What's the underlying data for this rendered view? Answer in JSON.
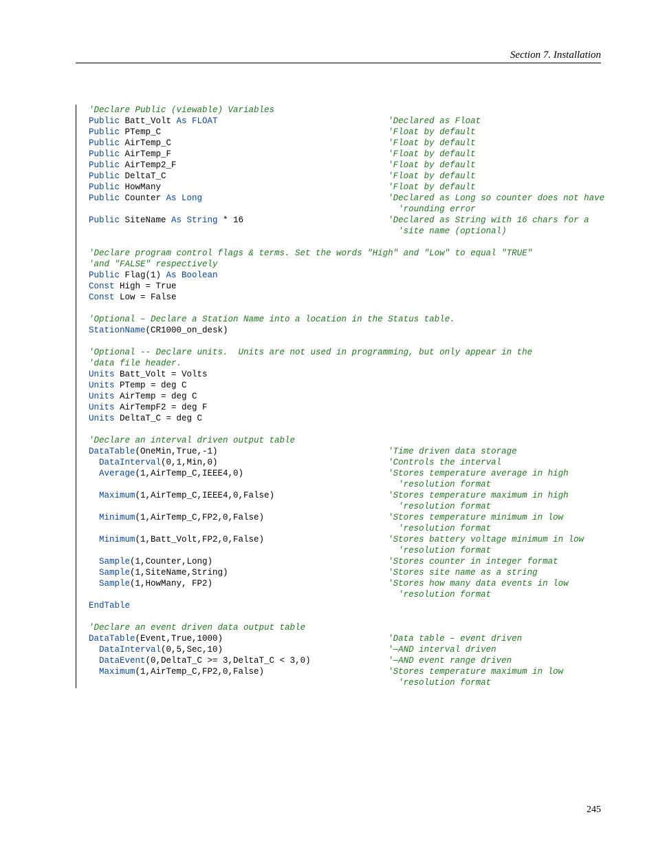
{
  "header": "Section 7.  Installation",
  "page_number": "245",
  "code_lines": [
    [
      [
        "c",
        "'Declare Public (viewable) Variables"
      ]
    ],
    [
      [
        "kw",
        "Public"
      ],
      [
        "t",
        " Batt_Volt "
      ],
      [
        "kw",
        "As FLOAT"
      ],
      [
        "pad",
        456
      ],
      [
        "c",
        "'Declared as Float"
      ]
    ],
    [
      [
        "kw",
        "Public"
      ],
      [
        "t",
        " PTemp_C"
      ],
      [
        "pad",
        456
      ],
      [
        "c",
        "'Float by default"
      ]
    ],
    [
      [
        "kw",
        "Public"
      ],
      [
        "t",
        " AirTemp_C"
      ],
      [
        "pad",
        456
      ],
      [
        "c",
        "'Float by default"
      ]
    ],
    [
      [
        "kw",
        "Public"
      ],
      [
        "t",
        " AirTemp_F"
      ],
      [
        "pad",
        456
      ],
      [
        "c",
        "'Float by default"
      ]
    ],
    [
      [
        "kw",
        "Public"
      ],
      [
        "t",
        " AirTemp2_F"
      ],
      [
        "pad",
        456
      ],
      [
        "c",
        "'Float by default"
      ]
    ],
    [
      [
        "kw",
        "Public"
      ],
      [
        "t",
        " DeltaT_C"
      ],
      [
        "pad",
        456
      ],
      [
        "c",
        "'Float by default"
      ]
    ],
    [
      [
        "kw",
        "Public"
      ],
      [
        "t",
        " HowMany"
      ],
      [
        "pad",
        456
      ],
      [
        "c",
        "'Float by default"
      ]
    ],
    [
      [
        "kw",
        "Public"
      ],
      [
        "t",
        " Counter "
      ],
      [
        "kw",
        "As Long"
      ],
      [
        "pad",
        456
      ],
      [
        "c",
        "'Declared as Long so counter does not have"
      ]
    ],
    [
      [
        "pad",
        471
      ],
      [
        "c",
        "'rounding error"
      ]
    ],
    [
      [
        "kw",
        "Public"
      ],
      [
        "t",
        " SiteName "
      ],
      [
        "kw",
        "As String"
      ],
      [
        "t",
        " * 16"
      ],
      [
        "pad",
        456
      ],
      [
        "c",
        "'Declared as String with 16 chars for a"
      ]
    ],
    [
      [
        "pad",
        471
      ],
      [
        "c",
        "'site name (optional)"
      ]
    ],
    [
      [
        "t",
        " "
      ]
    ],
    [
      [
        "c",
        "'Declare program control flags & terms. Set the words \"High\" and \"Low\" to equal \"TRUE\""
      ]
    ],
    [
      [
        "c",
        "'and \"FALSE\" respectively"
      ]
    ],
    [
      [
        "kw",
        "Public"
      ],
      [
        "t",
        " Flag(1) "
      ],
      [
        "kw",
        "As Boolean"
      ]
    ],
    [
      [
        "kw",
        "Const"
      ],
      [
        "t",
        " High = True"
      ]
    ],
    [
      [
        "kw",
        "Const"
      ],
      [
        "t",
        " Low = False"
      ]
    ],
    [
      [
        "t",
        " "
      ]
    ],
    [
      [
        "c",
        "'Optional – Declare a Station Name into a location in the Status table."
      ]
    ],
    [
      [
        "fn",
        "StationName"
      ],
      [
        "t",
        "(CR1000_on_desk)"
      ]
    ],
    [
      [
        "t",
        " "
      ]
    ],
    [
      [
        "c",
        "'Optional -- Declare units.  Units are not used in programming, but only appear in the"
      ]
    ],
    [
      [
        "c",
        "'data file header."
      ]
    ],
    [
      [
        "kw",
        "Units"
      ],
      [
        "t",
        " Batt_Volt = Volts"
      ]
    ],
    [
      [
        "kw",
        "Units"
      ],
      [
        "t",
        " PTemp = deg C"
      ]
    ],
    [
      [
        "kw",
        "Units"
      ],
      [
        "t",
        " AirTemp = deg C"
      ]
    ],
    [
      [
        "kw",
        "Units"
      ],
      [
        "t",
        " AirTempF2 = deg F"
      ]
    ],
    [
      [
        "kw",
        "Units"
      ],
      [
        "t",
        " DeltaT_C = deg C"
      ]
    ],
    [
      [
        "t",
        " "
      ]
    ],
    [
      [
        "c",
        "'Declare an interval driven output table"
      ]
    ],
    [
      [
        "fn",
        "DataTable"
      ],
      [
        "t",
        "(OneMin,True,-1)"
      ],
      [
        "pad",
        456
      ],
      [
        "c",
        "'Time driven data storage"
      ]
    ],
    [
      [
        "t",
        "  "
      ],
      [
        "fn",
        "DataInterval"
      ],
      [
        "t",
        "(0,1,Min,0)"
      ],
      [
        "pad",
        456
      ],
      [
        "c",
        "'Controls the interval"
      ]
    ],
    [
      [
        "t",
        "  "
      ],
      [
        "fn",
        "Average"
      ],
      [
        "t",
        "(1,AirTemp_C,IEEE4,0)"
      ],
      [
        "pad",
        456
      ],
      [
        "c",
        "'Stores temperature average in high"
      ]
    ],
    [
      [
        "pad",
        471
      ],
      [
        "c",
        "'resolution format"
      ]
    ],
    [
      [
        "t",
        "  "
      ],
      [
        "fn",
        "Maximum"
      ],
      [
        "t",
        "(1,AirTemp_C,IEEE4,0,False)"
      ],
      [
        "pad",
        456
      ],
      [
        "c",
        "'Stores temperature maximum in high"
      ]
    ],
    [
      [
        "pad",
        471
      ],
      [
        "c",
        "'resolution format"
      ]
    ],
    [
      [
        "t",
        "  "
      ],
      [
        "fn",
        "Minimum"
      ],
      [
        "t",
        "(1,AirTemp_C,FP2,0,False)"
      ],
      [
        "pad",
        456
      ],
      [
        "c",
        "'Stores temperature minimum in low"
      ]
    ],
    [
      [
        "pad",
        471
      ],
      [
        "c",
        "'resolution format"
      ]
    ],
    [
      [
        "t",
        "  "
      ],
      [
        "fn",
        "Minimum"
      ],
      [
        "t",
        "(1,Batt_Volt,FP2,0,False)"
      ],
      [
        "pad",
        456
      ],
      [
        "c",
        "'Stores battery voltage minimum in low"
      ]
    ],
    [
      [
        "pad",
        471
      ],
      [
        "c",
        "'resolution format"
      ]
    ],
    [
      [
        "t",
        "  "
      ],
      [
        "fn",
        "Sample"
      ],
      [
        "t",
        "(1,Counter,Long)"
      ],
      [
        "pad",
        456
      ],
      [
        "c",
        "'Stores counter in integer format"
      ]
    ],
    [
      [
        "t",
        "  "
      ],
      [
        "fn",
        "Sample"
      ],
      [
        "t",
        "(1,SiteName,String)"
      ],
      [
        "pad",
        456
      ],
      [
        "c",
        "'Stores site name as a string"
      ]
    ],
    [
      [
        "t",
        "  "
      ],
      [
        "fn",
        "Sample"
      ],
      [
        "t",
        "(1,HowMany, FP2)"
      ],
      [
        "pad",
        456
      ],
      [
        "c",
        "'Stores how many data events in low"
      ]
    ],
    [
      [
        "pad",
        471
      ],
      [
        "c",
        "'resolution format"
      ]
    ],
    [
      [
        "kw",
        "EndTable"
      ]
    ],
    [
      [
        "t",
        " "
      ]
    ],
    [
      [
        "c",
        "'Declare an event driven data output table"
      ]
    ],
    [
      [
        "fn",
        "DataTable"
      ],
      [
        "t",
        "(Event,True,1000)"
      ],
      [
        "pad",
        456
      ],
      [
        "c",
        "'Data table – event driven"
      ]
    ],
    [
      [
        "t",
        "  "
      ],
      [
        "fn",
        "DataInterval"
      ],
      [
        "t",
        "(0,5,Sec,10)"
      ],
      [
        "pad",
        456
      ],
      [
        "c",
        "'—AND interval driven"
      ]
    ],
    [
      [
        "t",
        "  "
      ],
      [
        "fn",
        "DataEvent"
      ],
      [
        "t",
        "(0,DeltaT_C >= 3,DeltaT_C < 3,0)"
      ],
      [
        "pad",
        456
      ],
      [
        "c",
        "'—AND event range driven"
      ]
    ],
    [
      [
        "t",
        "  "
      ],
      [
        "fn",
        "Maximum"
      ],
      [
        "t",
        "(1,AirTemp_C,FP2,0,False)"
      ],
      [
        "pad",
        456
      ],
      [
        "c",
        "'Stores temperature maximum in low"
      ]
    ],
    [
      [
        "pad",
        471
      ],
      [
        "c",
        "'resolution format"
      ]
    ]
  ]
}
